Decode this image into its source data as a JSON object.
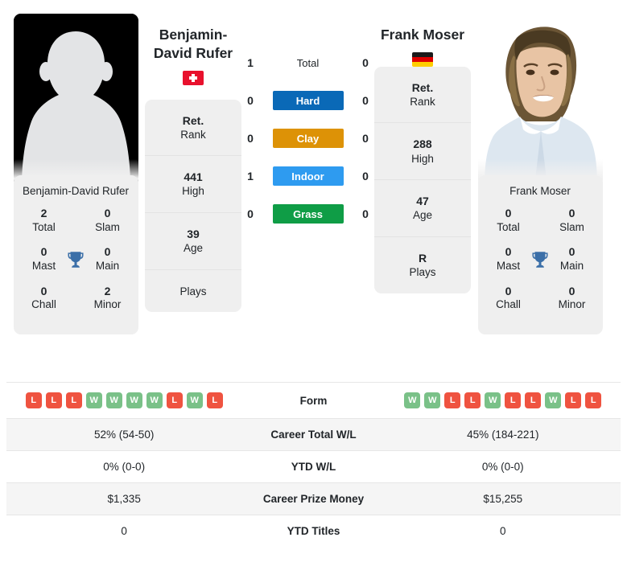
{
  "players": {
    "left": {
      "name": "Benjamin-David Rufer",
      "name_line1": "Benjamin-",
      "name_line2": "David Rufer",
      "country": "Switzerland",
      "flag": "swiss-flag",
      "photo_type": "silhouette-placeholder",
      "titles": {
        "total": "2",
        "total_label": "Total",
        "slam": "0",
        "slam_label": "Slam",
        "mast": "0",
        "mast_label": "Mast",
        "main": "0",
        "main_label": "Main",
        "chall": "0",
        "chall_label": "Chall",
        "minor": "2",
        "minor_label": "Minor"
      },
      "profile": {
        "rank": "Ret.",
        "rank_label": "Rank",
        "high": "441",
        "high_label": "High",
        "age": "39",
        "age_label": "Age",
        "plays": "",
        "plays_label": "Plays"
      },
      "form": [
        "L",
        "L",
        "L",
        "W",
        "W",
        "W",
        "W",
        "L",
        "W",
        "L"
      ],
      "career_total_wl": "52% (54-50)",
      "ytd_wl": "0% (0-0)",
      "career_prize_money": "$1,335",
      "ytd_titles": "0"
    },
    "right": {
      "name": "Frank Moser",
      "name_line1": "Frank Moser",
      "name_line2": "",
      "country": "Germany",
      "flag": "german-flag",
      "photo_type": "player-photo",
      "titles": {
        "total": "0",
        "total_label": "Total",
        "slam": "0",
        "slam_label": "Slam",
        "mast": "0",
        "mast_label": "Mast",
        "main": "0",
        "main_label": "Main",
        "chall": "0",
        "chall_label": "Chall",
        "minor": "0",
        "minor_label": "Minor"
      },
      "profile": {
        "rank": "Ret.",
        "rank_label": "Rank",
        "high": "288",
        "high_label": "High",
        "age": "47",
        "age_label": "Age",
        "plays": "R",
        "plays_label": "Plays"
      },
      "form": [
        "W",
        "W",
        "L",
        "L",
        "W",
        "L",
        "L",
        "W",
        "L",
        "L"
      ],
      "career_total_wl": "45% (184-221)",
      "ytd_wl": "0% (0-0)",
      "career_prize_money": "$15,255",
      "ytd_titles": "0"
    }
  },
  "head_to_head": {
    "rows": [
      {
        "label": "Total",
        "left": "1",
        "right": "0",
        "color": "none",
        "badge": false
      },
      {
        "label": "Hard",
        "left": "0",
        "right": "0",
        "color": "#0a69b7",
        "badge": true
      },
      {
        "label": "Clay",
        "left": "0",
        "right": "0",
        "color": "#dd9206",
        "badge": true
      },
      {
        "label": "Indoor",
        "left": "1",
        "right": "0",
        "color": "#2e9bf0",
        "badge": true
      },
      {
        "label": "Grass",
        "left": "0",
        "right": "0",
        "color": "#0f9d46",
        "badge": true
      }
    ]
  },
  "comparison_table": {
    "rows": [
      {
        "label": "Form",
        "type": "form",
        "left": "",
        "right": ""
      },
      {
        "label": "Career Total W/L",
        "type": "text",
        "left": "52% (54-50)",
        "right": "45% (184-221)"
      },
      {
        "label": "YTD W/L",
        "type": "text",
        "left": "0% (0-0)",
        "right": "0% (0-0)"
      },
      {
        "label": "Career Prize Money",
        "type": "text",
        "left": "$1,335",
        "right": "$15,255"
      },
      {
        "label": "YTD Titles",
        "type": "text",
        "left": "0",
        "right": "0"
      }
    ]
  },
  "colors": {
    "hard": "#0a69b7",
    "clay": "#dd9206",
    "indoor": "#2e9bf0",
    "grass": "#0f9d46",
    "win": "#7ac188",
    "loss": "#ef5340",
    "card_bg": "#efefef",
    "row_alt": "#f5f5f5"
  }
}
